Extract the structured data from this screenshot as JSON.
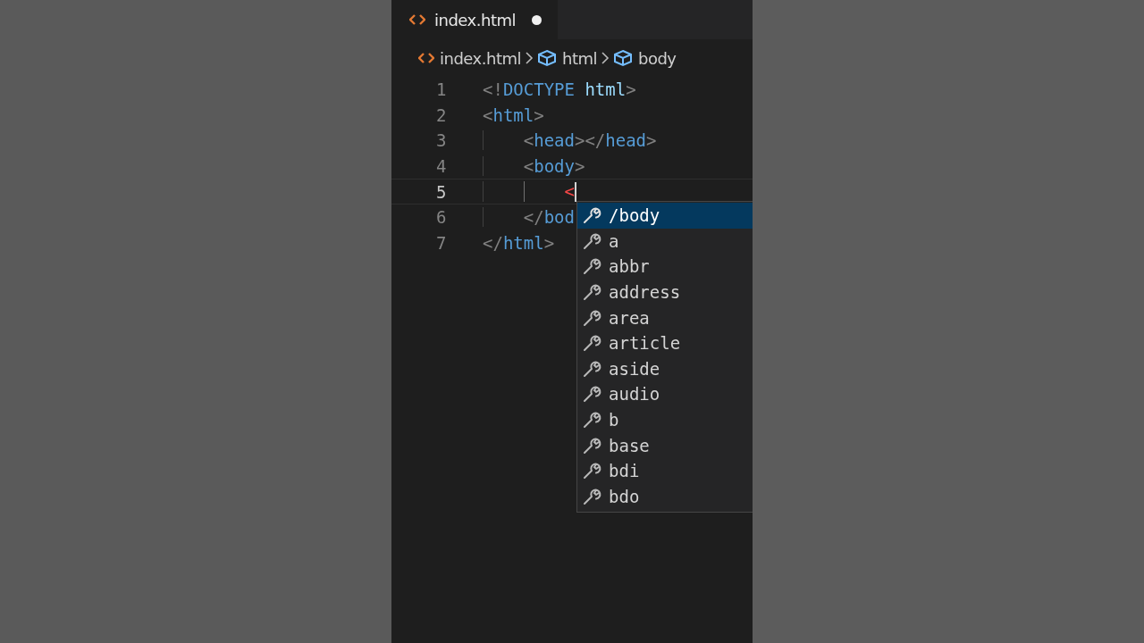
{
  "tab": {
    "label": "index.html",
    "modified": true
  },
  "breadcrumb": [
    {
      "kind": "file",
      "label": "index.html"
    },
    {
      "kind": "element",
      "label": "html"
    },
    {
      "kind": "element",
      "label": "body"
    }
  ],
  "lines": [
    {
      "number": "1",
      "current": false,
      "tokens": [
        {
          "kind": "punct",
          "text": "<!"
        },
        {
          "kind": "tag",
          "text": "DOCTYPE"
        },
        {
          "kind": "attr",
          "text": " html"
        },
        {
          "kind": "punct",
          "text": ">"
        }
      ]
    },
    {
      "number": "2",
      "current": false,
      "tokens": [
        {
          "kind": "punct",
          "text": "<"
        },
        {
          "kind": "tag",
          "text": "html"
        },
        {
          "kind": "punct",
          "text": ">"
        }
      ],
      "children": [
        {
          "number": "3",
          "current": false,
          "tokens": [
            {
              "kind": "punct",
              "text": "<"
            },
            {
              "kind": "tag",
              "text": "head"
            },
            {
              "kind": "punct",
              "text": "></"
            },
            {
              "kind": "tag",
              "text": "head"
            },
            {
              "kind": "punct",
              "text": ">"
            }
          ]
        },
        {
          "number": "4",
          "current": false,
          "tokens": [
            {
              "kind": "punct",
              "text": "<"
            },
            {
              "kind": "tag",
              "text": "body"
            },
            {
              "kind": "punct",
              "text": ">"
            }
          ],
          "children": [
            {
              "number": "5",
              "current": true,
              "tokens": [
                {
                  "kind": "error",
                  "text": "<"
                }
              ]
            }
          ]
        },
        {
          "number": "6",
          "current": false,
          "tokens": [
            {
              "kind": "punct",
              "text": "</"
            },
            {
              "kind": "tag",
              "text": "bod"
            }
          ]
        }
      ]
    },
    {
      "number": "7",
      "current": false,
      "tokens": [
        {
          "kind": "punct",
          "text": "</"
        },
        {
          "kind": "tag",
          "text": "html"
        },
        {
          "kind": "punct",
          "text": ">"
        }
      ]
    }
  ],
  "suggestions": [
    {
      "label": "/body",
      "selected": true
    },
    {
      "label": "a",
      "selected": false
    },
    {
      "label": "abbr",
      "selected": false
    },
    {
      "label": "address",
      "selected": false
    },
    {
      "label": "area",
      "selected": false
    },
    {
      "label": "article",
      "selected": false
    },
    {
      "label": "aside",
      "selected": false
    },
    {
      "label": "audio",
      "selected": false
    },
    {
      "label": "b",
      "selected": false
    },
    {
      "label": "base",
      "selected": false
    },
    {
      "label": "bdi",
      "selected": false
    },
    {
      "label": "bdo",
      "selected": false
    }
  ]
}
